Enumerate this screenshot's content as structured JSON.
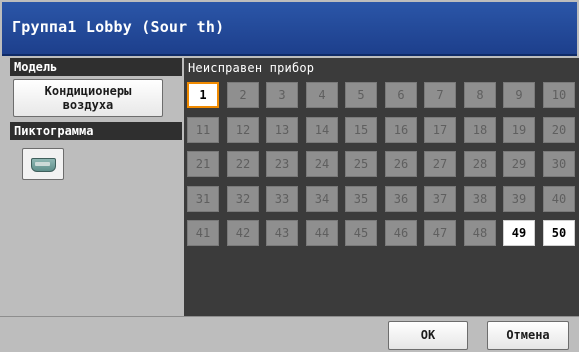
{
  "window": {
    "title": "Группа1 Lobby (Sour th)"
  },
  "left_panel": {
    "model_header": "Модель",
    "model_button_line1": "Кондиционеры",
    "model_button_line2": "воздуха",
    "icon_header": "Пиктограмма",
    "icon_name": "air-conditioner-icon"
  },
  "grid": {
    "label": "Неисправен прибор",
    "selected": 1,
    "enabled": [
      1,
      49,
      50
    ],
    "cells": [
      "1",
      "2",
      "3",
      "4",
      "5",
      "6",
      "7",
      "8",
      "9",
      "10",
      "11",
      "12",
      "13",
      "14",
      "15",
      "16",
      "17",
      "18",
      "19",
      "20",
      "21",
      "22",
      "23",
      "24",
      "25",
      "26",
      "27",
      "28",
      "29",
      "30",
      "31",
      "32",
      "33",
      "34",
      "35",
      "36",
      "37",
      "38",
      "39",
      "40",
      "41",
      "42",
      "43",
      "44",
      "45",
      "46",
      "47",
      "48",
      "49",
      "50"
    ]
  },
  "buttons": {
    "ok": "OK",
    "cancel": "Отмена"
  },
  "colors": {
    "title_bar": "#1d3f8c",
    "selection_outline": "#f08a00"
  }
}
